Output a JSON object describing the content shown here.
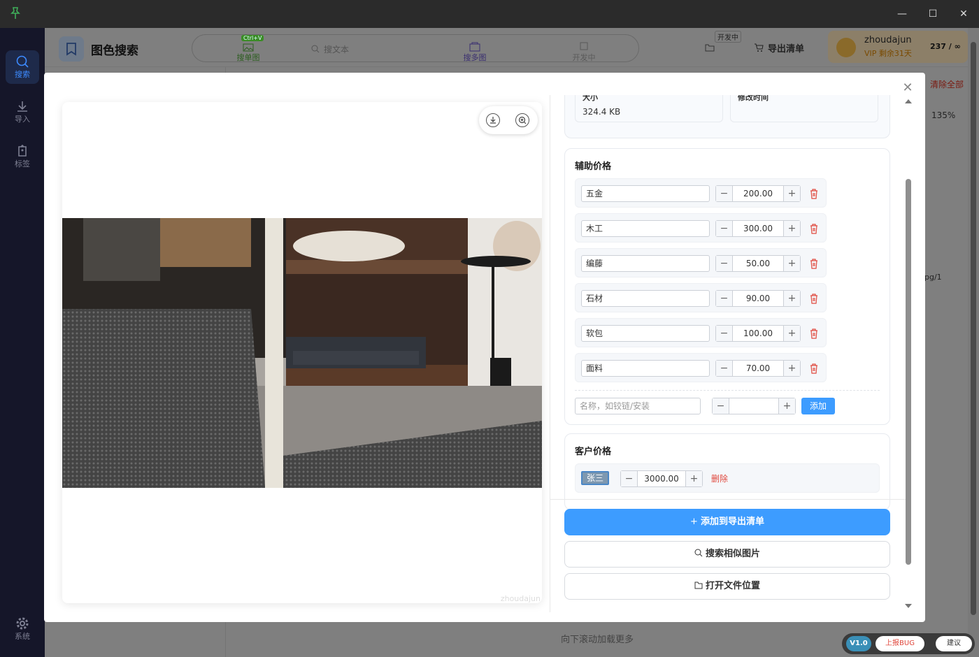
{
  "nav": {
    "items": [
      {
        "label": "搜索"
      },
      {
        "label": "导入"
      },
      {
        "label": "标签"
      },
      {
        "label": "系统"
      }
    ]
  },
  "header": {
    "brand_title": "图色搜索",
    "search_tabs": [
      {
        "label": "搜单图",
        "badge": "Ctrl+V"
      },
      {
        "label": "搜文本"
      },
      {
        "label": "搜多图"
      },
      {
        "label": "开发中"
      }
    ],
    "dev_badge": "开发中",
    "export_label": "导出清单",
    "user_name": "zhoudajun",
    "vip_text": "VIP 剩余31天",
    "quota": "237 / ∞"
  },
  "background": {
    "clear_all": "清除全部",
    "zoom": "135%",
    "file_hint": "pg/1",
    "scroll_hint": "向下滚动加载更多"
  },
  "modal": {
    "watermark": "zhoudajun",
    "meta": {
      "size_label": "大小",
      "size_value": "324.4 KB",
      "mtime_label": "修改时间"
    },
    "aux_price": {
      "title": "辅助价格",
      "rows": [
        {
          "name": "五金",
          "value": "200.00"
        },
        {
          "name": "木工",
          "value": "300.00"
        },
        {
          "name": "编藤",
          "value": "50.00"
        },
        {
          "name": "石材",
          "value": "90.00"
        },
        {
          "name": "软包",
          "value": "100.00"
        },
        {
          "name": "面料",
          "value": "70.00"
        }
      ],
      "new_placeholder": "名称，如铰链/安装",
      "add_label": "添加"
    },
    "client_price": {
      "title": "客户价格",
      "client_name": "张三",
      "value": "3000.00",
      "delete_label": "删除"
    },
    "actions": {
      "add_export": "添加到导出清单",
      "search_similar": "搜索相似图片",
      "open_location": "打开文件位置"
    }
  },
  "footer": {
    "version": "V1.0",
    "bug": "上报BUG",
    "suggest": "建议"
  },
  "colors": {
    "accent": "#3d9cff",
    "danger": "#e0483d",
    "nav_bg": "#151629"
  }
}
